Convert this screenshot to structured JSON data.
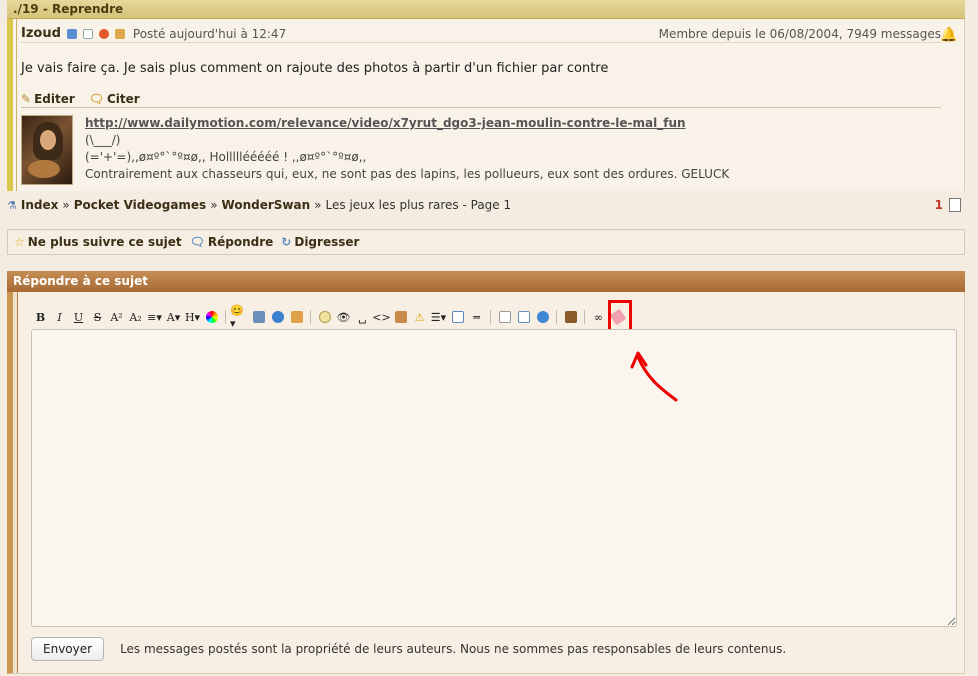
{
  "post": {
    "header_title": "./19 - Reprendre",
    "author": "Izoud",
    "posted_at": "Posté aujourd'hui à 12:47",
    "member_since": "Membre depuis le 06/08/2004, 7949 messages",
    "message": "Je vais faire ça. Je sais plus comment on rajoute des photos à partir d'un fichier par contre",
    "edit_label": "Editer",
    "quote_label": "Citer",
    "signature": {
      "link": "http://www.dailymotion.com/relevance/video/x7yrut_dgo3-jean-moulin-contre-le-mal_fun",
      "line1": "(\\___/)",
      "line2": "(='+'=),,ø¤º°`°º¤ø,, Holllllééééé ! ,,ø¤º°`°º¤ø,,",
      "line3": "Contrairement aux chasseurs qui, eux, ne sont pas des lapins, les pollueurs, eux sont des ordures. GELUCK"
    }
  },
  "breadcrumb": {
    "items": [
      "Index",
      "Pocket Videogames",
      "WonderSwan"
    ],
    "current": "Les jeux les plus rares - Page 1",
    "separator": "»",
    "page_number": "1"
  },
  "follow_bar": {
    "unfollow_label": "Ne plus suivre ce sujet",
    "reply_label": "Répondre",
    "digress_label": "Digresser"
  },
  "reply": {
    "header_title": "Répondre à ce sujet",
    "editor_value": "",
    "send_label": "Envoyer",
    "disclaimer": "Les messages postés sont la propriété de leurs auteurs. Nous ne sommes pas responsables de leurs contenus."
  },
  "toolbar": {
    "bold": "B",
    "italic": "I",
    "underline": "U",
    "strike": "S",
    "superscript": "A²",
    "subscript": "A₂",
    "font_size": "A",
    "heading": "H"
  },
  "colors": {
    "post_header": "#d6c47a",
    "reply_header": "#a86a35",
    "highlight": "#e00000",
    "page_number": "#c0392b"
  }
}
